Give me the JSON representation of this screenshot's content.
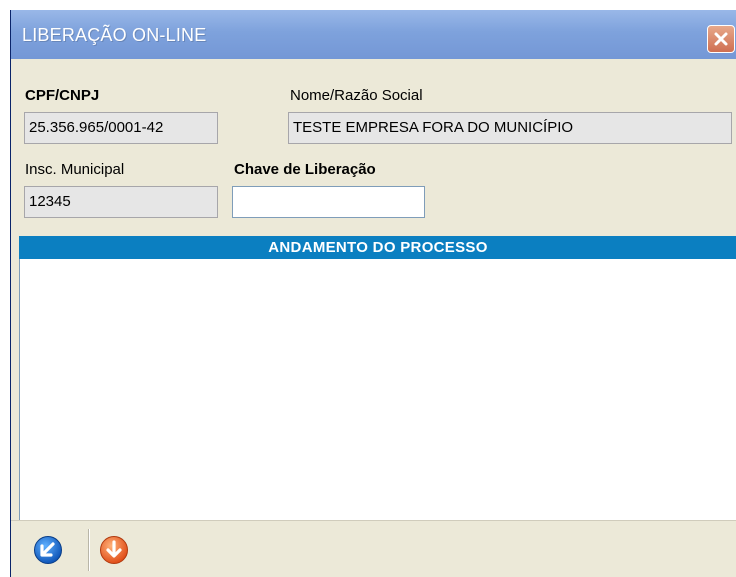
{
  "window": {
    "title": "LIBERAÇÃO ON-LINE"
  },
  "form": {
    "cpf_label": "CPF/CNPJ",
    "cpf_value": "25.356.965/0001-42",
    "nome_label": "Nome/Razão Social",
    "nome_value": "TESTE EMPRESA FORA DO MUNICÍPIO",
    "insc_label": "Insc. Municipal",
    "insc_value": "12345",
    "chave_label": "Chave de Liberação",
    "chave_value": ""
  },
  "panel": {
    "title": "ANDAMENTO DO PROCESSO"
  },
  "toolbar": {
    "buttons": [
      {
        "icon": "arrow-down-left-icon",
        "color": "#1a6fd1"
      },
      {
        "icon": "arrow-down-icon",
        "color": "#e8642a"
      }
    ]
  },
  "colors": {
    "titlebar": "#7ea2dc",
    "panel_header": "#0b7fc1",
    "close_button": "#cf6f52"
  }
}
